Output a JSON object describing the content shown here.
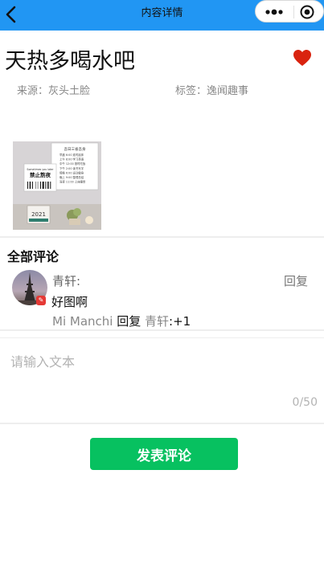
{
  "nav": {
    "title": "内容详情",
    "back_icon": "chevron-left-icon",
    "more_icon": "more-dots-icon",
    "close_icon": "target-circle-icon",
    "bar_color": "#2196f3"
  },
  "article": {
    "title": "天热多喝水吧",
    "source": "来源：灰头土脸",
    "tag": "标签：逸闻趣事",
    "favorite_icon": "heart-icon",
    "favorite_color": "#d9230f",
    "image": {
      "sign_header": "吾日三省吾身",
      "sign_lines": [
        "早晨 6:00 准时起床",
        "上午 8:00 学习英语",
        "中午 12:00 按时吃饭",
        "下午 2:00 读书写字",
        "傍晚 6:00 运动健身",
        "晚上 9:00 整理总结",
        "深夜 11:00 上床睡觉"
      ],
      "notice_top": "Sometimes you later",
      "notice_main": "禁止熬夜",
      "calendar_year": "2021"
    }
  },
  "comments": {
    "section_title": "全部评论",
    "items": [
      {
        "author": "青轩:",
        "text": "好图啊",
        "reply_label": "回复",
        "reply": {
          "from": "Mi Manchi",
          "verb": "回复",
          "to": "青轩",
          "content": ":+1"
        }
      }
    ]
  },
  "composer": {
    "placeholder": "请输入文本",
    "value": "",
    "counter": "0/50",
    "submit_label": "发表评论",
    "submit_color": "#07c160"
  }
}
